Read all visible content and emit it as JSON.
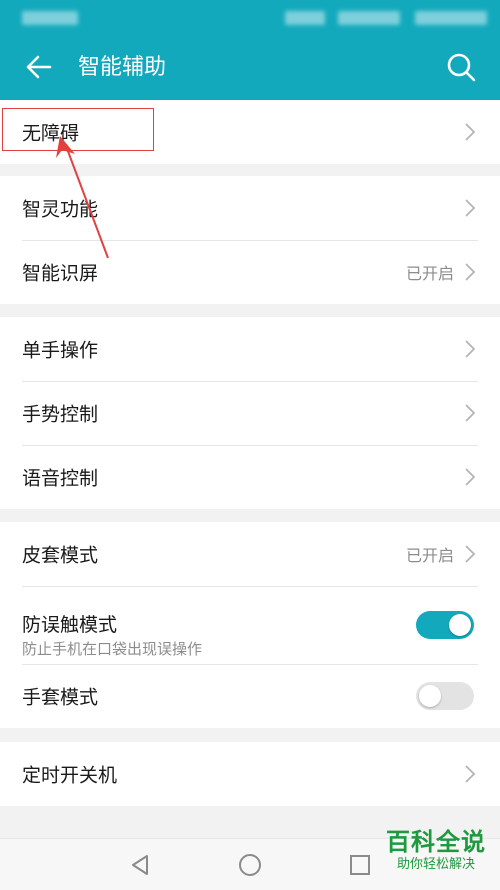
{
  "header": {
    "title": "智能辅助",
    "back_icon": "back-arrow-icon",
    "search_icon": "search-icon"
  },
  "groups": [
    {
      "items": [
        {
          "label": "无障碍",
          "status": ""
        }
      ]
    },
    {
      "items": [
        {
          "label": "智灵功能",
          "status": ""
        },
        {
          "label": "智能识屏",
          "status": "已开启"
        }
      ]
    },
    {
      "items": [
        {
          "label": "单手操作",
          "status": ""
        },
        {
          "label": "手势控制",
          "status": ""
        },
        {
          "label": "语音控制",
          "status": ""
        }
      ]
    },
    {
      "items": [
        {
          "label": "皮套模式",
          "status": "已开启"
        },
        {
          "label": "防误触模式",
          "subtitle": "防止手机在口袋出现误操作",
          "toggle": "on"
        },
        {
          "label": "手套模式",
          "toggle": "off"
        }
      ]
    },
    {
      "items": [
        {
          "label": "定时开关机",
          "status": ""
        }
      ]
    }
  ],
  "colors": {
    "accent": "#13a9bd",
    "annotation": "#e04040",
    "watermark": "#1c9a3d"
  },
  "navbar": {
    "icons": [
      "triangle-back-icon",
      "circle-home-icon",
      "square-recents-icon"
    ]
  },
  "watermark": {
    "main": "百科全说",
    "sub": "助你轻松解决"
  }
}
